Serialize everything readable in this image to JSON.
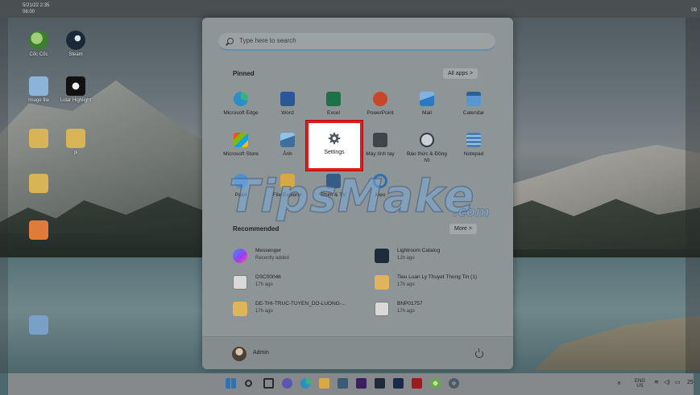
{
  "desktop": {
    "top_label_line1": "5/21/22 2:35",
    "top_label_line2": "06:00",
    "top_right": "09",
    "icons": [
      {
        "name": "app-icon-coc-coc",
        "label": "Cốc Cốc",
        "color": "#6aa84f"
      },
      {
        "name": "app-icon-steam",
        "label": "Steam",
        "color": "#1b2838"
      },
      {
        "name": "app-icon-image-file",
        "label": "Image file",
        "color": "#8db3d9"
      },
      {
        "name": "app-icon-eye-app",
        "label": "Lidar Highlight",
        "color": "#111111"
      },
      {
        "name": "app-icon-folder",
        "label": "",
        "color": "#d8b456"
      },
      {
        "name": "app-icon-folder-pi",
        "label": "pi",
        "color": "#d8b456"
      },
      {
        "name": "app-icon-folder-2",
        "label": "",
        "color": "#d8b456"
      },
      {
        "name": "app-icon-orange",
        "label": "",
        "color": "#e07b39"
      },
      {
        "name": "app-icon-network",
        "label": "",
        "color": "#7aa0c8"
      }
    ]
  },
  "start_menu": {
    "search_placeholder": "Type here to search",
    "pinned_title": "Pinned",
    "all_apps_label": "All apps  >",
    "pinned": [
      {
        "name": "pinned-microsoft-edge",
        "label": "Microsoft Edge",
        "icon": "edge-icon",
        "color": "#2a8fc4"
      },
      {
        "name": "pinned-word",
        "label": "Word",
        "icon": "word-icon",
        "color": "#2b5797"
      },
      {
        "name": "pinned-excel",
        "label": "Excel",
        "icon": "excel-icon",
        "color": "#1e7145"
      },
      {
        "name": "pinned-powerpoint",
        "label": "PowerPoint",
        "icon": "powerpoint-icon",
        "color": "#c8472a"
      },
      {
        "name": "pinned-mail",
        "label": "Mail",
        "icon": "mail-icon",
        "color": "#2b79c2"
      },
      {
        "name": "pinned-calendar",
        "label": "Calendar",
        "icon": "calendar-icon",
        "color": "#3b7cc4"
      },
      {
        "name": "pinned-microsoft-store",
        "label": "Microsoft Store",
        "icon": "store-icon",
        "color": "#3a5a7a"
      },
      {
        "name": "pinned-anh",
        "label": "Ảnh",
        "icon": "photos-icon",
        "color": "#3d6f9e"
      },
      {
        "name": "pinned-settings",
        "label": "Settings",
        "icon": "gear-icon",
        "color": "#4d5b66"
      },
      {
        "name": "pinned-may-tinh-tay",
        "label": "Máy tính tay",
        "icon": "calculator-icon",
        "color": "#3f4448"
      },
      {
        "name": "pinned-bao-thuc",
        "label": "Báo thức & Đồng hồ",
        "icon": "clock-icon",
        "color": "#2f3a44"
      },
      {
        "name": "pinned-notepad",
        "label": "Notepad",
        "icon": "notepad-icon",
        "color": "#4a7fb3"
      },
      {
        "name": "pinned-paint",
        "label": "Paint",
        "icon": "paint-icon",
        "color": "#4d8fcf"
      },
      {
        "name": "pinned-file-explorer",
        "label": "File Explorer",
        "icon": "folder-icon",
        "color": "#d6a942"
      },
      {
        "name": "pinned-phim-tv",
        "label": "Phim & TV",
        "icon": "movies-icon",
        "color": "#345c86"
      },
      {
        "name": "pinned-meo",
        "label": "Mẹo",
        "icon": "tips-icon",
        "color": "#2f6fb0"
      }
    ],
    "recommended_title": "Recommended",
    "more_label": "More  >",
    "recommended": [
      {
        "name": "rec-messenger",
        "title": "Messenger",
        "sub": "Recently added",
        "icon": "messenger-icon",
        "color": "#7a4bd6"
      },
      {
        "name": "rec-lightroom",
        "title": "Lightroom Catalog",
        "sub": "12h ago",
        "icon": "lightroom-icon",
        "color": "#1f2b38"
      },
      {
        "name": "rec-dsc00046",
        "title": "DSC00046",
        "sub": "17h ago",
        "icon": "image-file-icon",
        "color": "#d9d9d9"
      },
      {
        "name": "rec-tieu-luan",
        "title": "Tieu Luan Ly Thuyet Thong Tin (1)",
        "sub": "17h ago",
        "icon": "document-icon",
        "color": "#e0b45a"
      },
      {
        "name": "rec-de-thi",
        "title": "DE-THI-TRUC-TUYEN_DO-LUONG-...",
        "sub": "17h ago",
        "icon": "document-icon",
        "color": "#e0b45a"
      },
      {
        "name": "rec-bnp01757",
        "title": "BNP01757",
        "sub": "17h ago",
        "icon": "image-file-icon",
        "color": "#d9d9d9"
      }
    ],
    "user_name": "Admin"
  },
  "taskbar": {
    "items": [
      {
        "name": "taskbar-start",
        "icon": "windows-icon",
        "color": "#2f73b5"
      },
      {
        "name": "taskbar-search",
        "icon": "search-icon",
        "color": "#2a2a2a"
      },
      {
        "name": "taskbar-task-view",
        "icon": "task-view-icon",
        "color": "#2a2a2a"
      },
      {
        "name": "taskbar-chat",
        "icon": "chat-icon",
        "color": "#5b56b0"
      },
      {
        "name": "taskbar-edge",
        "icon": "edge-icon",
        "color": "#2a8fc4"
      },
      {
        "name": "taskbar-explorer",
        "icon": "folder-icon",
        "color": "#d6a942"
      },
      {
        "name": "taskbar-store",
        "icon": "store-icon",
        "color": "#3a5a7a"
      },
      {
        "name": "taskbar-premiere",
        "icon": "premiere-icon",
        "color": "#3a1f5c"
      },
      {
        "name": "taskbar-lightroom",
        "icon": "lightroom-icon",
        "color": "#1f2b38"
      },
      {
        "name": "taskbar-photoshop",
        "icon": "photoshop-icon",
        "color": "#1b2a48"
      },
      {
        "name": "taskbar-red-app",
        "icon": "red-app-icon",
        "color": "#9c1c1c"
      },
      {
        "name": "taskbar-coc-coc",
        "icon": "coc-coc-icon",
        "color": "#6aa84f"
      },
      {
        "name": "taskbar-settings",
        "icon": "gear-icon",
        "color": "#4d5b66"
      }
    ],
    "tray": {
      "lang_line1": "ENG",
      "lang_line2": "US",
      "clock": "25"
    }
  },
  "watermark": {
    "main": "TipsMake",
    "suffix": ".com"
  }
}
